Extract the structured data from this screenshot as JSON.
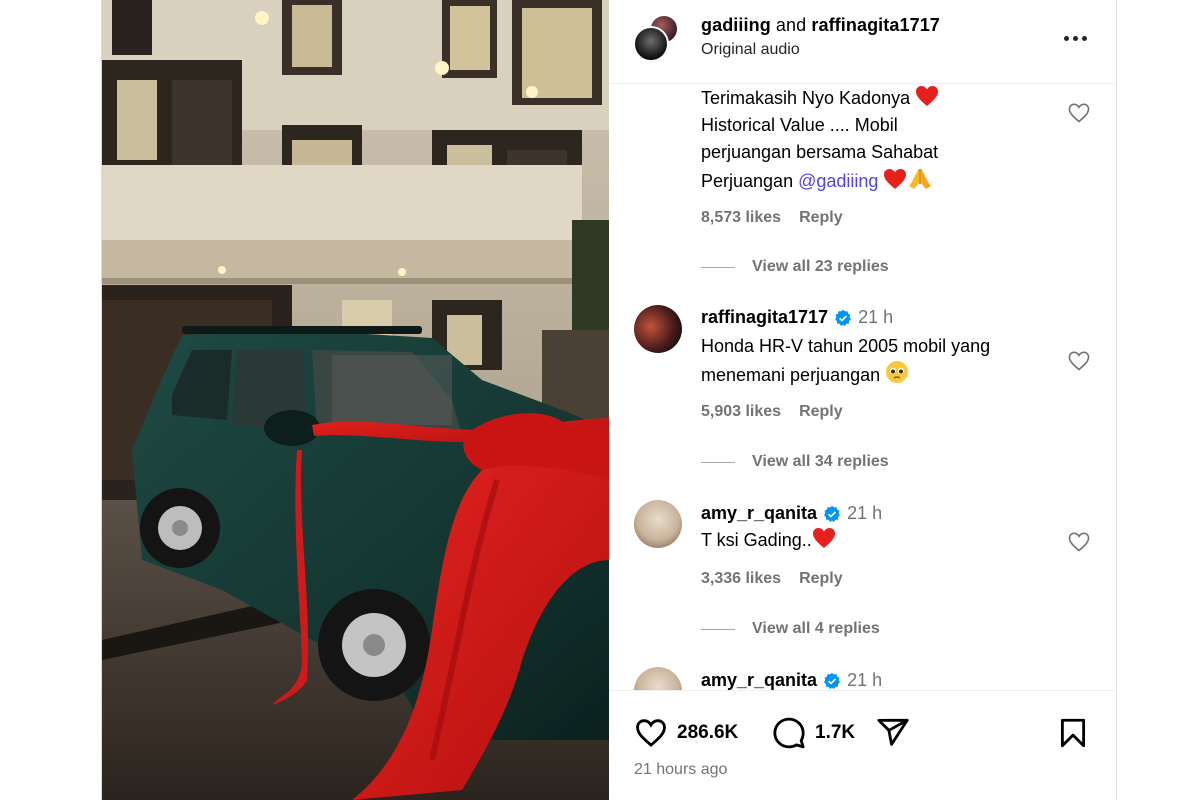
{
  "header": {
    "author_primary": "gadiiing",
    "and_text": "and",
    "author_secondary": "raffinagita1717",
    "audio": "Original audio",
    "more_icon": "more-horizontal-icon"
  },
  "comments": [
    {
      "id": "c0",
      "text_lines": [
        "Terimakasih Nyo Kadonya",
        "Historical Value .... Mobil",
        "perjuangan bersama Sahabat",
        "Perjuangan"
      ],
      "mention": "@gadiiing",
      "likes": "8,573 likes",
      "reply": "Reply",
      "view_replies": "View all 23 replies"
    },
    {
      "id": "c1",
      "username": "raffinagita1717",
      "verified": true,
      "time": "21 h",
      "text_lines": [
        "Honda HR-V tahun 2005 mobil yang",
        "menemani perjuangan"
      ],
      "likes": "5,903 likes",
      "reply": "Reply",
      "view_replies": "View all 34 replies"
    },
    {
      "id": "c2",
      "username": "amy_r_qanita",
      "verified": true,
      "time": "21 h",
      "text": "T ksi Gading..",
      "likes": "3,336 likes",
      "reply": "Reply",
      "view_replies": "View all 4 replies"
    },
    {
      "id": "c3",
      "username": "amy_r_qanita",
      "verified": true,
      "time": "21 h"
    }
  ],
  "actions": {
    "like_count": "286.6K",
    "comment_count": "1.7K",
    "posted": "21 hours ago"
  },
  "colors": {
    "mention": "#4f46e5",
    "verified": "#0095f6",
    "secondary_text": "#737373"
  }
}
